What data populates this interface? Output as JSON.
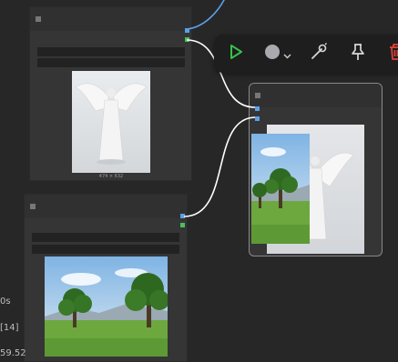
{
  "node_image_angel": {
    "dimensions_label": "474 × 632"
  },
  "left_panel_fragments": [
    "0s",
    "[14]",
    "59.52"
  ],
  "toolbar": {
    "run_icon": "play-icon",
    "color_icon": "color-circle-icon",
    "color_menu_icon": "chevron-down-icon",
    "bypass_icon": "bypass-wand-icon",
    "pin_icon": "pin-icon",
    "delete_icon": "trash-icon"
  },
  "colors": {
    "canvas": "#272727",
    "node_body": "#353535",
    "port_image": "#5ba0ea",
    "port_mask": "#4bbf5b",
    "run_green": "#35c24a",
    "delete_red": "#e0443a",
    "wire_blue": "#5ba0ea",
    "wire_white": "#ffffff"
  }
}
